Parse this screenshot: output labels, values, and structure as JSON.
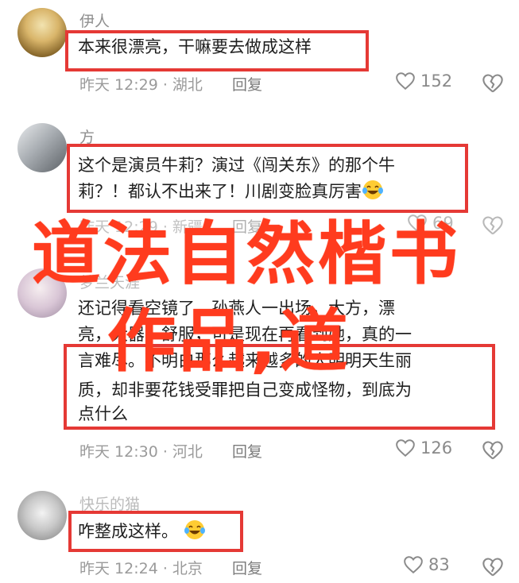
{
  "comments": [
    {
      "username": "伊人",
      "lines": [
        "本来很漂亮，干嘛要去做成这样"
      ],
      "meta": "昨天 12:29 · 湖北",
      "reply": "回复",
      "likes": "152"
    },
    {
      "username": "方",
      "lines": [
        "这个是演员牛莉？演过《闯关东》的那个牛",
        "莉？！都认不出来了！川剧变脸真厉害"
      ],
      "meta": "昨天 12:29 · 新疆",
      "reply": "回复",
      "likes": "69"
    },
    {
      "username": "梦兰天涯",
      "lines": [
        "还记得看空镜了，孙燕人一出场，大方，漂",
        "亮，大器，舒服，可是现在再看到她，真的一",
        "言难尽。不明白那么越来越多的人明明天生丽",
        "质，却非要花钱受罪把自己变成怪物，到底为",
        "点什么"
      ],
      "meta": "昨天 12:30 · 河北",
      "reply": "回复",
      "likes": "126"
    },
    {
      "username": "快乐的猫",
      "lines": [
        "咋整成这样。"
      ],
      "meta": "昨天 12:24 · 北京",
      "reply": "回复",
      "likes": "83"
    }
  ],
  "watermark": {
    "line1": "道法自然楷书",
    "line2": "作品,道"
  },
  "colors": {
    "highlight_border": "#e53935",
    "watermark": "#ff3b1e"
  },
  "icons": {
    "like": "heart-outline-icon",
    "dislike": "broken-heart-icon",
    "emoji": "laughing-tears-emoji-icon"
  }
}
